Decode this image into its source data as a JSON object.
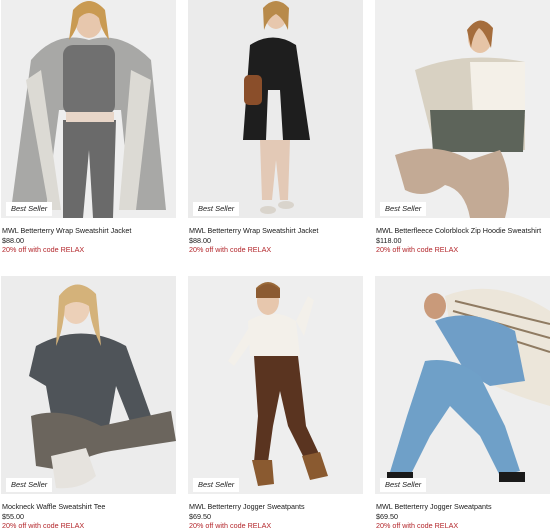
{
  "products": [
    {
      "name": "MWL Betterterry Wrap Sweatshirt Jacket",
      "price": "$88.00",
      "promo": "20% off with code RELAX",
      "badge": "Best Seller"
    },
    {
      "name": "MWL Betterterry Wrap Sweatshirt Jacket",
      "price": "$88.00",
      "promo": "20% off with code RELAX",
      "badge": "Best Seller"
    },
    {
      "name": "MWL Betterfleece Colorblock Zip Hoodie Sweatshirt",
      "price": "$118.00",
      "promo": "20% off with code RELAX",
      "badge": "Best Seller"
    },
    {
      "name": "Mockneck Waffle Sweatshirt Tee",
      "price": "$55.00",
      "promo": "20% off with code RELAX",
      "badge": "Best Seller"
    },
    {
      "name": "MWL Betterterry Jogger Sweatpants",
      "price": "$69.50",
      "promo": "20% off with code RELAX",
      "badge": "Best Seller"
    },
    {
      "name": "MWL Betterterry Jogger Sweatpants",
      "price": "$69.50",
      "promo": "20% off with code RELAX",
      "badge": "Best Seller"
    }
  ],
  "colors": {
    "promo": "#b3262b",
    "image_bg": "#ededed",
    "page_bg": "#ffffff"
  }
}
